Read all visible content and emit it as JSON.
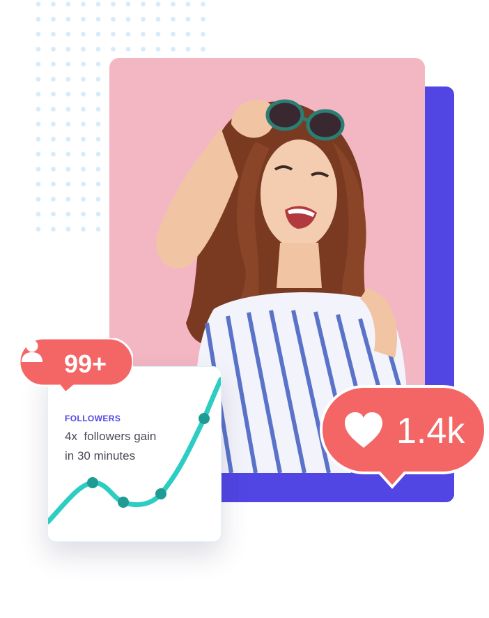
{
  "colors": {
    "accent_purple": "#5145e4",
    "bubble_red": "#f46565",
    "curve_teal": "#2ecdc4",
    "curve_dot": "#1d9b94",
    "photo_background": "#f3b7c3",
    "dot_grid": "#d6ecfb"
  },
  "followers_badge": {
    "icon": "user-icon",
    "count": "99+"
  },
  "followers_card": {
    "label": "FOLLOWERS",
    "description_line1": "4x  followers gain",
    "description_line2": "in 30 minutes"
  },
  "likes_badge": {
    "icon": "heart-icon",
    "count": "1.4k"
  },
  "photo": {
    "subject": "woman-with-sunglasses-photo"
  }
}
